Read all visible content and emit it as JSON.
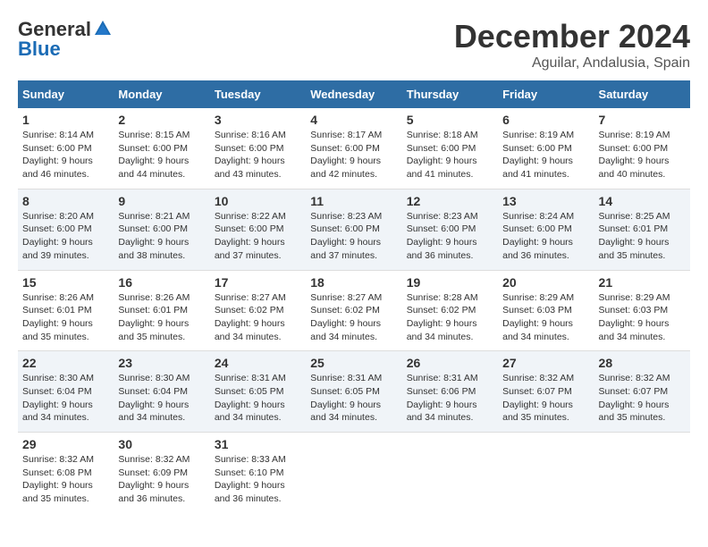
{
  "header": {
    "logo_general": "General",
    "logo_blue": "Blue",
    "month": "December 2024",
    "location": "Aguilar, Andalusia, Spain"
  },
  "weekdays": [
    "Sunday",
    "Monday",
    "Tuesday",
    "Wednesday",
    "Thursday",
    "Friday",
    "Saturday"
  ],
  "weeks": [
    [
      {
        "day": "1",
        "sunrise": "8:14 AM",
        "sunset": "6:00 PM",
        "daylight": "9 hours and 46 minutes."
      },
      {
        "day": "2",
        "sunrise": "8:15 AM",
        "sunset": "6:00 PM",
        "daylight": "9 hours and 44 minutes."
      },
      {
        "day": "3",
        "sunrise": "8:16 AM",
        "sunset": "6:00 PM",
        "daylight": "9 hours and 43 minutes."
      },
      {
        "day": "4",
        "sunrise": "8:17 AM",
        "sunset": "6:00 PM",
        "daylight": "9 hours and 42 minutes."
      },
      {
        "day": "5",
        "sunrise": "8:18 AM",
        "sunset": "6:00 PM",
        "daylight": "9 hours and 41 minutes."
      },
      {
        "day": "6",
        "sunrise": "8:19 AM",
        "sunset": "6:00 PM",
        "daylight": "9 hours and 41 minutes."
      },
      {
        "day": "7",
        "sunrise": "8:19 AM",
        "sunset": "6:00 PM",
        "daylight": "9 hours and 40 minutes."
      }
    ],
    [
      {
        "day": "8",
        "sunrise": "8:20 AM",
        "sunset": "6:00 PM",
        "daylight": "9 hours and 39 minutes."
      },
      {
        "day": "9",
        "sunrise": "8:21 AM",
        "sunset": "6:00 PM",
        "daylight": "9 hours and 38 minutes."
      },
      {
        "day": "10",
        "sunrise": "8:22 AM",
        "sunset": "6:00 PM",
        "daylight": "9 hours and 37 minutes."
      },
      {
        "day": "11",
        "sunrise": "8:23 AM",
        "sunset": "6:00 PM",
        "daylight": "9 hours and 37 minutes."
      },
      {
        "day": "12",
        "sunrise": "8:23 AM",
        "sunset": "6:00 PM",
        "daylight": "9 hours and 36 minutes."
      },
      {
        "day": "13",
        "sunrise": "8:24 AM",
        "sunset": "6:00 PM",
        "daylight": "9 hours and 36 minutes."
      },
      {
        "day": "14",
        "sunrise": "8:25 AM",
        "sunset": "6:01 PM",
        "daylight": "9 hours and 35 minutes."
      }
    ],
    [
      {
        "day": "15",
        "sunrise": "8:26 AM",
        "sunset": "6:01 PM",
        "daylight": "9 hours and 35 minutes."
      },
      {
        "day": "16",
        "sunrise": "8:26 AM",
        "sunset": "6:01 PM",
        "daylight": "9 hours and 35 minutes."
      },
      {
        "day": "17",
        "sunrise": "8:27 AM",
        "sunset": "6:02 PM",
        "daylight": "9 hours and 34 minutes."
      },
      {
        "day": "18",
        "sunrise": "8:27 AM",
        "sunset": "6:02 PM",
        "daylight": "9 hours and 34 minutes."
      },
      {
        "day": "19",
        "sunrise": "8:28 AM",
        "sunset": "6:02 PM",
        "daylight": "9 hours and 34 minutes."
      },
      {
        "day": "20",
        "sunrise": "8:29 AM",
        "sunset": "6:03 PM",
        "daylight": "9 hours and 34 minutes."
      },
      {
        "day": "21",
        "sunrise": "8:29 AM",
        "sunset": "6:03 PM",
        "daylight": "9 hours and 34 minutes."
      }
    ],
    [
      {
        "day": "22",
        "sunrise": "8:30 AM",
        "sunset": "6:04 PM",
        "daylight": "9 hours and 34 minutes."
      },
      {
        "day": "23",
        "sunrise": "8:30 AM",
        "sunset": "6:04 PM",
        "daylight": "9 hours and 34 minutes."
      },
      {
        "day": "24",
        "sunrise": "8:31 AM",
        "sunset": "6:05 PM",
        "daylight": "9 hours and 34 minutes."
      },
      {
        "day": "25",
        "sunrise": "8:31 AM",
        "sunset": "6:05 PM",
        "daylight": "9 hours and 34 minutes."
      },
      {
        "day": "26",
        "sunrise": "8:31 AM",
        "sunset": "6:06 PM",
        "daylight": "9 hours and 34 minutes."
      },
      {
        "day": "27",
        "sunrise": "8:32 AM",
        "sunset": "6:07 PM",
        "daylight": "9 hours and 35 minutes."
      },
      {
        "day": "28",
        "sunrise": "8:32 AM",
        "sunset": "6:07 PM",
        "daylight": "9 hours and 35 minutes."
      }
    ],
    [
      {
        "day": "29",
        "sunrise": "8:32 AM",
        "sunset": "6:08 PM",
        "daylight": "9 hours and 35 minutes."
      },
      {
        "day": "30",
        "sunrise": "8:32 AM",
        "sunset": "6:09 PM",
        "daylight": "9 hours and 36 minutes."
      },
      {
        "day": "31",
        "sunrise": "8:33 AM",
        "sunset": "6:10 PM",
        "daylight": "9 hours and 36 minutes."
      },
      null,
      null,
      null,
      null
    ]
  ],
  "labels": {
    "sunrise_prefix": "Sunrise: ",
    "sunset_prefix": "Sunset: ",
    "daylight_prefix": "Daylight: "
  }
}
